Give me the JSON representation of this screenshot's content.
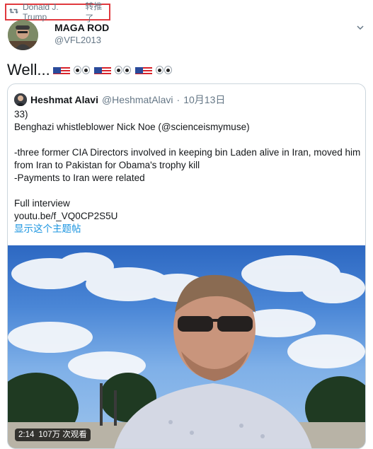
{
  "retweet": {
    "retweeter": "Donald J. Trump",
    "action": "转推了"
  },
  "tweet": {
    "display_name": "MAGA ROD",
    "handle": "@VFL2013",
    "text": "Well...",
    "emoji_sequence": [
      "us-flag",
      "eyes",
      "us-flag",
      "eyes",
      "us-flag",
      "eyes"
    ]
  },
  "quoted_tweet": {
    "display_name": "Heshmat Alavi",
    "handle": "@HeshmatAlavi",
    "separator": "·",
    "date": "10月13日",
    "lines": [
      "33)",
      "Benghazi whistleblower Nick Noe (@scienceismymuse)",
      "",
      "-three former CIA Directors involved in keeping bin Laden alive in Iran, moved him",
      "from Iran to Pakistan for Obama's trophy kill",
      "-Payments to Iran were related",
      "",
      "Full interview",
      "youtu.be/f_VQ0CP2S5U"
    ],
    "show_thread": "显示这个主题帖",
    "video": {
      "duration": "2:14",
      "views": "107万 次观看"
    }
  },
  "colors": {
    "highlight_border": "#e0393e",
    "secondary_text": "#657786",
    "link": "#1b95e0"
  }
}
